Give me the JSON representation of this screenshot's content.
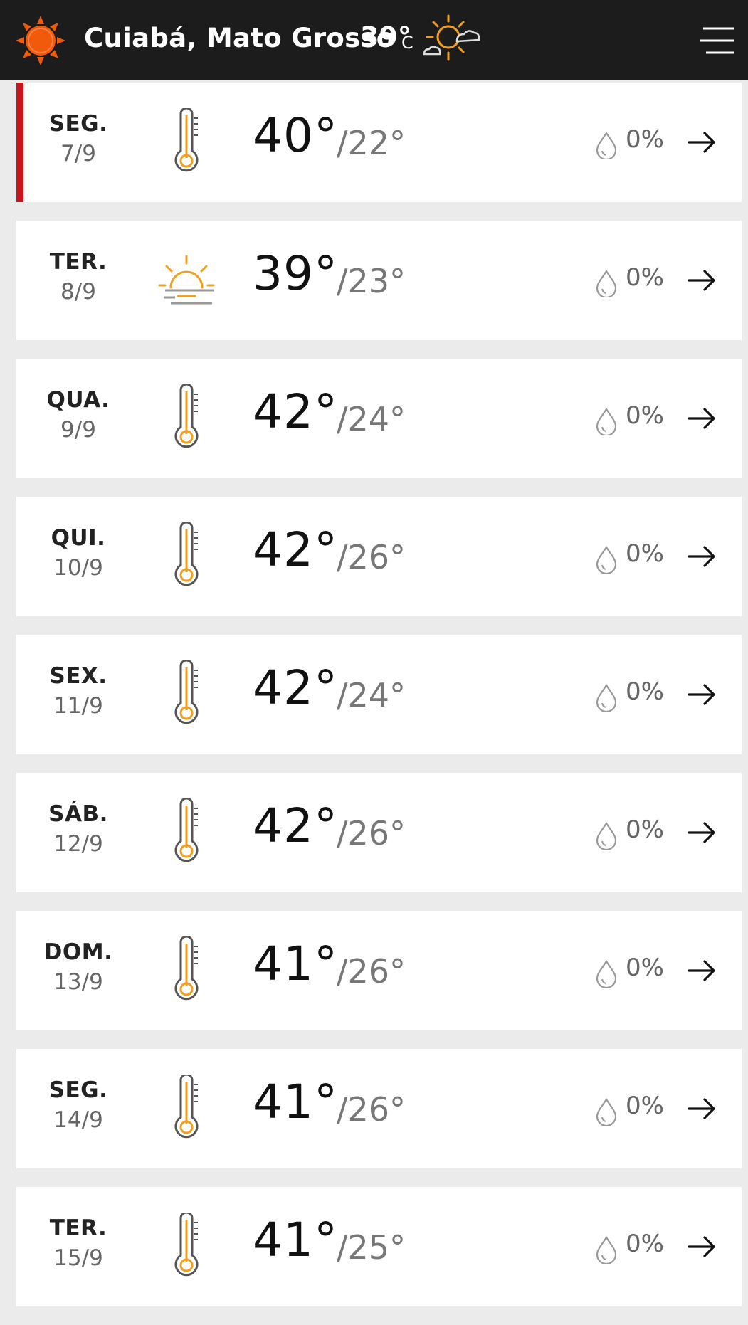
{
  "header": {
    "location": "Cuiabá, Mato Grosso",
    "temperature": "39°",
    "unit": "C",
    "weather_icon": "sun-cloud-icon",
    "logo_icon": "sun-logo-icon",
    "menu_icon": "hamburger-menu-icon"
  },
  "colors": {
    "header_bg": "#1c1c1c",
    "accent_orange": "#f05a0a",
    "icon_orange": "#f0a020",
    "active_day_marker": "#c8141c"
  },
  "days": [
    {
      "name": "SEG.",
      "date": "7/9",
      "max": "40°",
      "min": "/22°",
      "rain": "0%",
      "icon": "thermometer-icon"
    },
    {
      "name": "TER.",
      "date": "8/9",
      "max": "39°",
      "min": "/23°",
      "rain": "0%",
      "icon": "sun-haze-icon"
    },
    {
      "name": "QUA.",
      "date": "9/9",
      "max": "42°",
      "min": "/24°",
      "rain": "0%",
      "icon": "thermometer-icon"
    },
    {
      "name": "QUI.",
      "date": "10/9",
      "max": "42°",
      "min": "/26°",
      "rain": "0%",
      "icon": "thermometer-icon"
    },
    {
      "name": "SEX.",
      "date": "11/9",
      "max": "42°",
      "min": "/24°",
      "rain": "0%",
      "icon": "thermometer-icon"
    },
    {
      "name": "SÁB.",
      "date": "12/9",
      "max": "42°",
      "min": "/26°",
      "rain": "0%",
      "icon": "thermometer-icon"
    },
    {
      "name": "DOM.",
      "date": "13/9",
      "max": "41°",
      "min": "/26°",
      "rain": "0%",
      "icon": "thermometer-icon"
    },
    {
      "name": "SEG.",
      "date": "14/9",
      "max": "41°",
      "min": "/26°",
      "rain": "0%",
      "icon": "thermometer-icon"
    },
    {
      "name": "TER.",
      "date": "15/9",
      "max": "41°",
      "min": "/25°",
      "rain": "0%",
      "icon": "thermometer-icon"
    }
  ]
}
